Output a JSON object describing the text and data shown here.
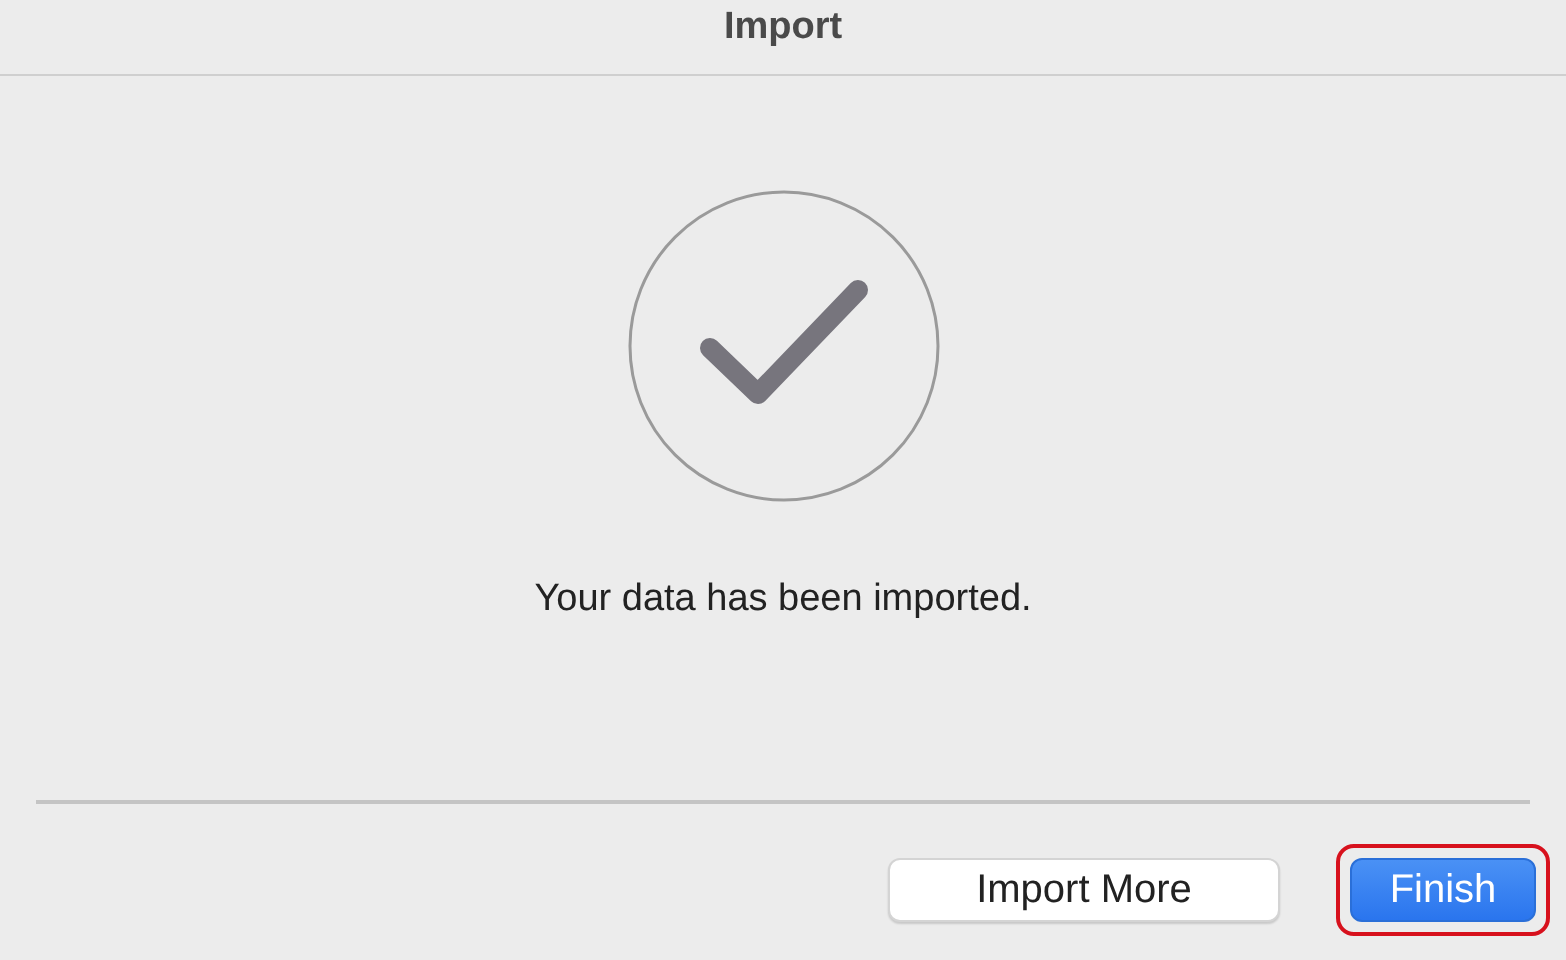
{
  "window": {
    "title": "Import"
  },
  "message": "Your data has been imported.",
  "buttons": [
    {
      "label": "Import More",
      "kind": "secondary",
      "highlighted": false
    },
    {
      "label": "Finish",
      "kind": "default",
      "highlighted": true
    }
  ]
}
